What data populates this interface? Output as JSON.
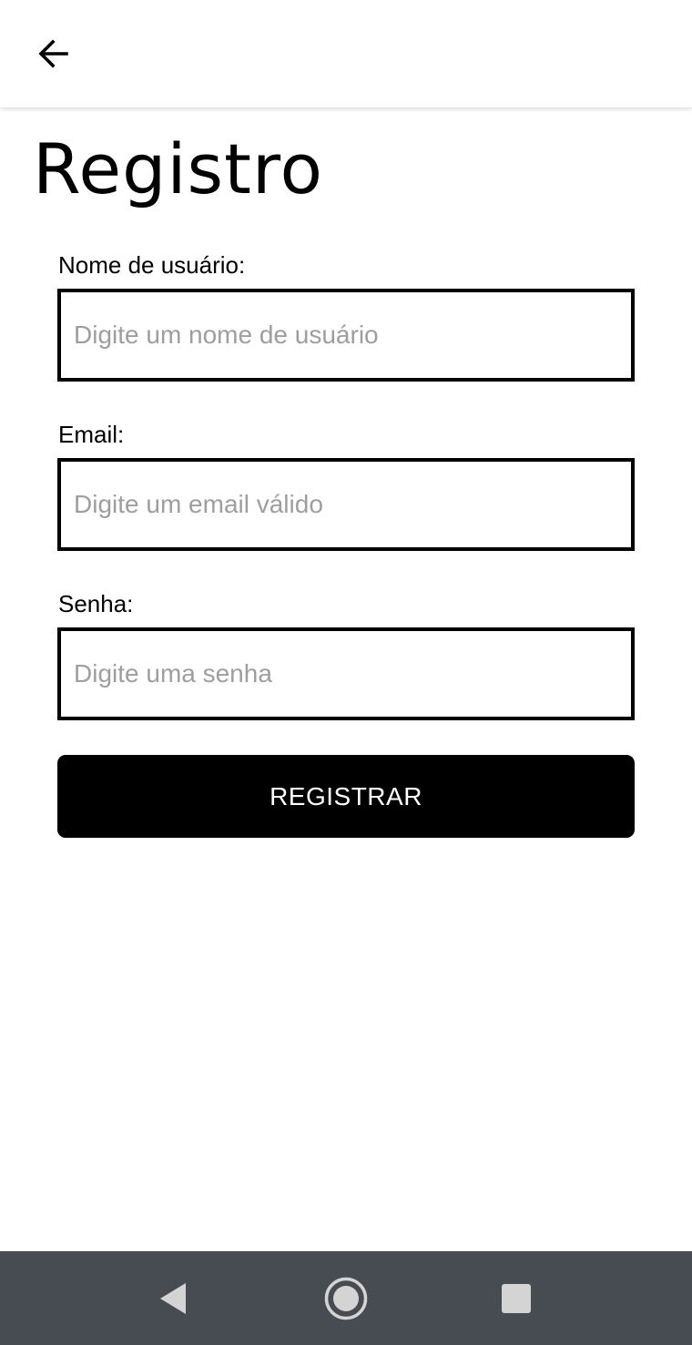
{
  "header": {
    "back_icon": "arrow-left-icon"
  },
  "page": {
    "title": "Registro"
  },
  "form": {
    "username": {
      "label": "Nome de usuário:",
      "placeholder": "Digite um nome de usuário",
      "value": ""
    },
    "email": {
      "label": "Email:",
      "placeholder": "Digite um email válido",
      "value": ""
    },
    "password": {
      "label": "Senha:",
      "placeholder": "Digite uma senha",
      "value": ""
    },
    "submit_label": "REGISTRAR"
  },
  "system_nav": {
    "back_icon": "triangle-back-icon",
    "home_icon": "circle-home-icon",
    "recents_icon": "square-recents-icon"
  },
  "colors": {
    "background": "#ffffff",
    "text": "#000000",
    "placeholder": "#9e9e9e",
    "button": "#000000",
    "button_text": "#ffffff",
    "navbar": "#474c52",
    "navbar_icons": "#d4d4d4"
  }
}
